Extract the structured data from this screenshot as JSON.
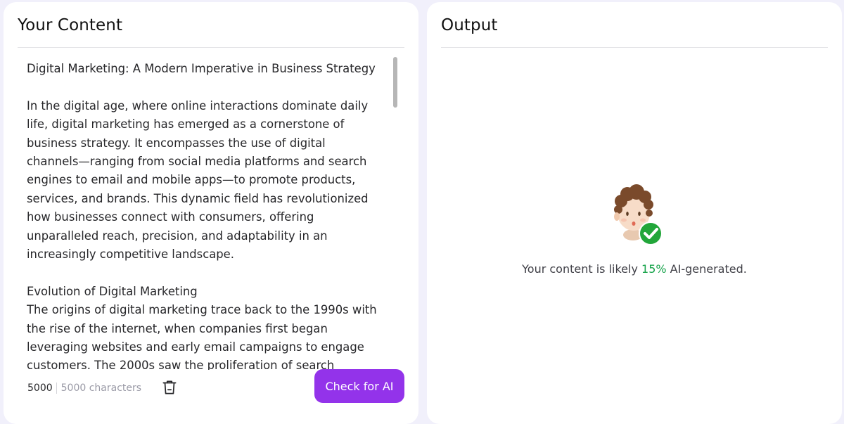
{
  "input_panel": {
    "title": "Your Content",
    "text_title": "Digital Marketing: A Modern Imperative in Business Strategy",
    "paragraph_1": [
      "In the digital age, where online interactions dominate daily",
      "life, digital marketing has emerged as a cornerstone of",
      "business strategy. It encompasses the use of digital",
      "channels—ranging from social media platforms and search",
      "engines to email and mobile apps—to promote products,",
      "services, and brands. This dynamic field has revolutionized",
      "how businesses connect with consumers, offering",
      "unparalleled reach, precision, and adaptability in an",
      "increasingly competitive landscape."
    ],
    "section_heading": "Evolution of Digital Marketing",
    "paragraph_2": [
      "The origins of digital marketing trace back to the 1990s with",
      "the rise of the internet, when companies first began",
      "leveraging websites and early email campaigns to engage",
      "customers. The 2000s saw the proliferation of search"
    ],
    "char_count": "5000",
    "char_limit_label": "5000 characters",
    "trash_icon": "trash-icon",
    "check_button_label": "Check for AI",
    "accent_color": "#9333ea"
  },
  "output_panel": {
    "title": "Output",
    "avatar_icon": "human-avatar-check-icon",
    "result_prefix": "Your content is likely ",
    "result_percent": "15%",
    "result_suffix": " AI-generated.",
    "percent_color": "#16a34a"
  }
}
